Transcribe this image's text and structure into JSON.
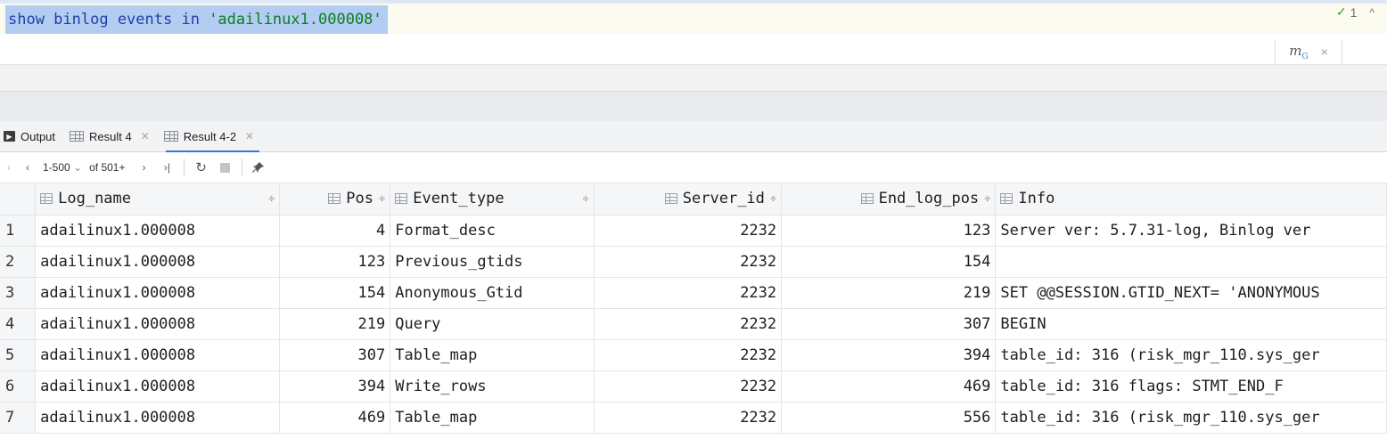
{
  "editor": {
    "query_keyword": "show binlog events in",
    "query_string": "'adailinux1.000008'",
    "inspection": {
      "check_symbol": "✓",
      "count": "1",
      "caret": "^"
    },
    "popup": {
      "m_label": "m",
      "m_sub": "G",
      "close": "×"
    }
  },
  "tabs": [
    {
      "label": "Output",
      "icon": "terminal-icon",
      "closable": false,
      "active": false
    },
    {
      "label": "Result 4",
      "icon": "table-grid-icon",
      "closable": true,
      "active": false
    },
    {
      "label": "Result 4-2",
      "icon": "table-grid-icon",
      "closable": true,
      "active": true
    }
  ],
  "toolbar": {
    "first": "‹",
    "prev": "‹",
    "range": "1-500",
    "range_caret": "⌄",
    "of_label": "of 501+",
    "next": "›",
    "last": "›|",
    "refresh": "↻",
    "pin": "📌"
  },
  "grid": {
    "columns": [
      {
        "name": "Log_name",
        "sortable": true
      },
      {
        "name": "Pos",
        "sortable": true
      },
      {
        "name": "Event_type",
        "sortable": true
      },
      {
        "name": "Server_id",
        "sortable": true
      },
      {
        "name": "End_log_pos",
        "sortable": true
      },
      {
        "name": "Info",
        "sortable": false
      }
    ],
    "sort_symbol": "÷",
    "rows": [
      {
        "num": "1",
        "log_name": "adailinux1.000008",
        "pos": "4",
        "event_type": "Format_desc",
        "server_id": "2232",
        "end_log_pos": "123",
        "info": "Server ver: 5.7.31-log, Binlog ver"
      },
      {
        "num": "2",
        "log_name": "adailinux1.000008",
        "pos": "123",
        "event_type": "Previous_gtids",
        "server_id": "2232",
        "end_log_pos": "154",
        "info": ""
      },
      {
        "num": "3",
        "log_name": "adailinux1.000008",
        "pos": "154",
        "event_type": "Anonymous_Gtid",
        "server_id": "2232",
        "end_log_pos": "219",
        "info": "SET @@SESSION.GTID_NEXT= 'ANONYMOUS"
      },
      {
        "num": "4",
        "log_name": "adailinux1.000008",
        "pos": "219",
        "event_type": "Query",
        "server_id": "2232",
        "end_log_pos": "307",
        "info": "BEGIN"
      },
      {
        "num": "5",
        "log_name": "adailinux1.000008",
        "pos": "307",
        "event_type": "Table_map",
        "server_id": "2232",
        "end_log_pos": "394",
        "info": "table_id: 316 (risk_mgr_110.sys_ger"
      },
      {
        "num": "6",
        "log_name": "adailinux1.000008",
        "pos": "394",
        "event_type": "Write_rows",
        "server_id": "2232",
        "end_log_pos": "469",
        "info": "table_id: 316 flags: STMT_END_F"
      },
      {
        "num": "7",
        "log_name": "adailinux1.000008",
        "pos": "469",
        "event_type": "Table_map",
        "server_id": "2232",
        "end_log_pos": "556",
        "info": "table_id: 316 (risk_mgr_110.sys_ger"
      }
    ]
  }
}
